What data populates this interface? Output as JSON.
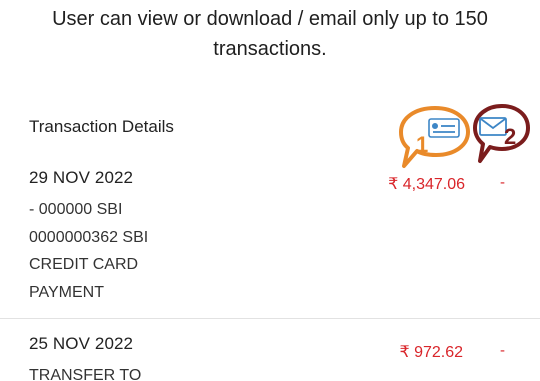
{
  "notice": {
    "line1": "User can view or download / email only up to 150",
    "line2": "transactions."
  },
  "section": {
    "title": "Transaction Details"
  },
  "callouts": [
    {
      "number": "1",
      "icon": "view-card-icon",
      "color": "#e98a2a"
    },
    {
      "number": "2",
      "icon": "email-icon",
      "color": "#7b1d1d"
    }
  ],
  "transactions": [
    {
      "date": "29 NOV 2022",
      "description": [
        "- 000000 SBI",
        "0000000362 SBI",
        "CREDIT CARD",
        "PAYMENT"
      ],
      "amount": "₹ 4,347.06",
      "extra": "-"
    },
    {
      "date": "25 NOV 2022",
      "description": [
        "TRANSFER TO"
      ],
      "amount": "₹ 972.62",
      "extra": "-"
    }
  ],
  "colors": {
    "amount": "#d9252a",
    "divider": "#e2e2e2"
  }
}
